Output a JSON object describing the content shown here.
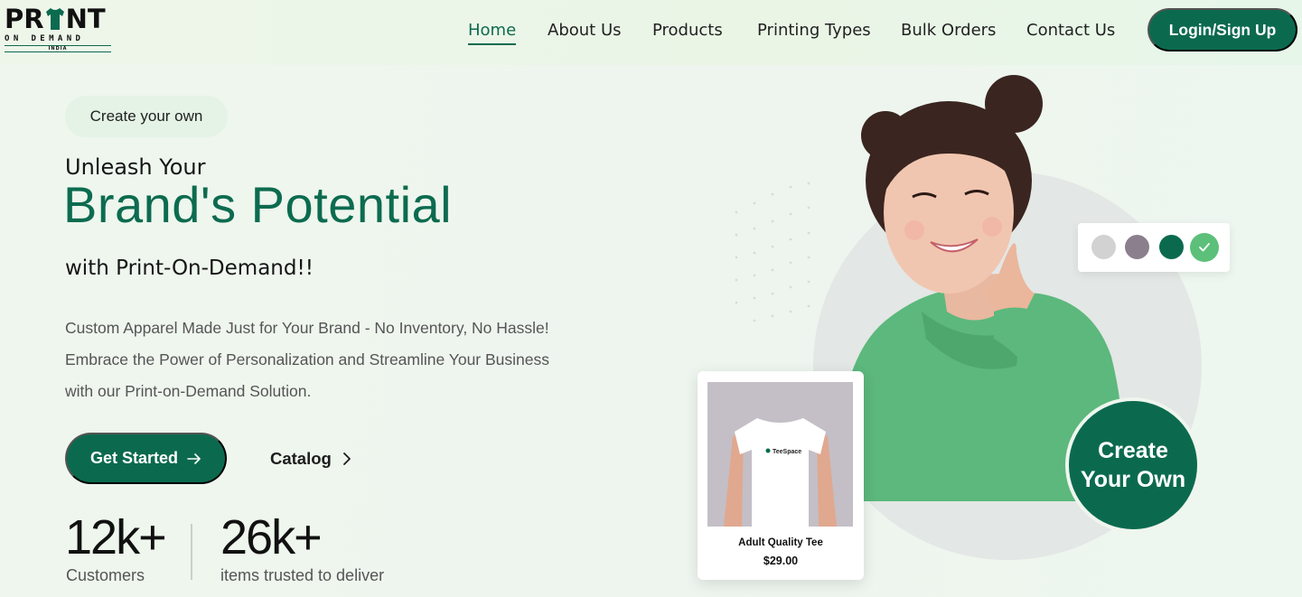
{
  "brand": {
    "logo_line1": "PR",
    "logo_line1_end": "NT",
    "logo_line2": "ON DEMAND",
    "logo_line3": "INDIA"
  },
  "nav": {
    "items": [
      {
        "label": "Home",
        "active": true
      },
      {
        "label": "About Us",
        "active": false
      },
      {
        "label": "Products",
        "active": false
      },
      {
        "label": "Printing Types",
        "active": false
      },
      {
        "label": "Bulk Orders",
        "active": false
      },
      {
        "label": "Contact Us",
        "active": false
      }
    ],
    "login_label": "Login/Sign Up"
  },
  "hero": {
    "pill": "Create your own",
    "heading_small": "Unleash Your",
    "heading_big": "Brand's Potential",
    "heading_sub": "with Print-On-Demand!!",
    "description": [
      "Custom Apparel Made Just for Your Brand - No Inventory, No Hassle!",
      "Embrace the Power of Personalization and Streamline Your Business",
      "with our Print-on-Demand Solution."
    ],
    "get_started_label": "Get Started",
    "catalog_label": "Catalog",
    "stats": [
      {
        "value": "12k+",
        "label": "Customers"
      },
      {
        "value": "26k+",
        "label": "items trusted to deliver"
      }
    ]
  },
  "product_card": {
    "shirt_brand": "TeeSpace",
    "name": "Adult Quality Tee",
    "price": "$29.00"
  },
  "swatches": {
    "colors": [
      "#d2d2d2",
      "#8b7f8e",
      "#0b6a4e",
      "#5cc07a"
    ],
    "selected_index": 3
  },
  "badge": {
    "line1": "Create",
    "line2": "Your Own"
  },
  "colors": {
    "brand_green": "#0b6a4e",
    "hoodie_green": "#5cb87c",
    "background": "#eef6ee"
  }
}
